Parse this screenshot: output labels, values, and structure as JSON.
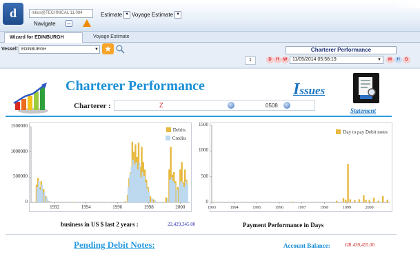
{
  "header": {
    "user": "nikos@TECHNICAL 11.084",
    "estimate_label": "Estimate",
    "voyage_estimate_label": "Voyage Estimate",
    "navigate_label": "Navigate"
  },
  "tabs": [
    {
      "label": "Wizard for EDINBURGH",
      "active": true
    },
    {
      "label": "Voyage Estimate",
      "active": false
    }
  ],
  "toolbar": {
    "vessel_label": "Vessel:",
    "vessel_value": "EDINBURGH",
    "page_number": "1",
    "report_title": "Charterer Performance",
    "date_value": "11/05/2014 05:58:19",
    "nav_left": [
      "D",
      "H",
      "W"
    ],
    "nav_right": [
      "M",
      "H",
      "D"
    ]
  },
  "main": {
    "title": "Charterer Performance",
    "charterer_label": "Charterer :",
    "charterer_value": "Z",
    "charterer_code": "0508",
    "issues_link_initial": "I",
    "issues_link_rest": "ssues",
    "statement_link": "Statement",
    "business_label": "business  in  US $  last 2 years :",
    "business_value": "22,429,345.00",
    "payment_label": "Payment Performance in Days",
    "pending_link": "Pending Debit Notes:",
    "balance_label": "Account Balance:",
    "balance_value": "GR  439,455.00"
  },
  "colors": {
    "title_blue": "#1a8fd6",
    "debits": "#e7b93e",
    "credits": "#bcd9f2",
    "value_red": "#d21a1a"
  },
  "chart_data": [
    {
      "type": "bar",
      "title": "",
      "xlabel": "",
      "ylabel": "",
      "xlim": [
        1990.5,
        2000.6
      ],
      "ylim": [
        0,
        1500000
      ],
      "yticks": [
        "1500000",
        "1000000",
        "500000",
        "0"
      ],
      "xticks": [
        "1992",
        "1994",
        "1996",
        "1998",
        "2000"
      ],
      "legend": "top-right",
      "series": [
        {
          "name": "Debits",
          "color": "#e7b93e",
          "points": [
            [
              1990.85,
              350000
            ],
            [
              1990.95,
              480000
            ],
            [
              1991.05,
              300000
            ],
            [
              1991.15,
              420000
            ],
            [
              1991.3,
              260000
            ],
            [
              1991.45,
              120000
            ],
            [
              1991.6,
              30000
            ],
            [
              1991.75,
              15000
            ],
            [
              1993.2,
              10000
            ],
            [
              1995.3,
              8000
            ],
            [
              1996.5,
              20000
            ],
            [
              1996.65,
              150000
            ],
            [
              1996.75,
              480000
            ],
            [
              1996.85,
              600000
            ],
            [
              1996.95,
              1200000
            ],
            [
              1997.05,
              1000000
            ],
            [
              1997.15,
              1150000
            ],
            [
              1997.25,
              900000
            ],
            [
              1997.35,
              1180000
            ],
            [
              1997.45,
              700000
            ],
            [
              1997.55,
              1100000
            ],
            [
              1997.65,
              800000
            ],
            [
              1997.75,
              650000
            ],
            [
              1997.85,
              450000
            ],
            [
              1997.95,
              300000
            ],
            [
              1998.1,
              120000
            ],
            [
              1998.3,
              60000
            ],
            [
              1999.1,
              100000
            ],
            [
              1999.3,
              650000
            ],
            [
              1999.4,
              1100000
            ],
            [
              1999.5,
              550000
            ],
            [
              1999.6,
              600000
            ],
            [
              1999.7,
              420000
            ],
            [
              1999.85,
              300000
            ],
            [
              2000.0,
              650000
            ],
            [
              2000.1,
              800000
            ],
            [
              2000.2,
              400000
            ],
            [
              2000.3,
              650000
            ],
            [
              2000.4,
              450000
            ]
          ]
        },
        {
          "name": "Credits",
          "color": "#bcd9f2",
          "points": [
            [
              1990.9,
              300000
            ],
            [
              1991.0,
              420000
            ],
            [
              1991.1,
              250000
            ],
            [
              1991.2,
              350000
            ],
            [
              1991.35,
              200000
            ],
            [
              1991.5,
              100000
            ],
            [
              1991.65,
              25000
            ],
            [
              1991.8,
              10000
            ],
            [
              1993.3,
              8000
            ],
            [
              1995.4,
              6000
            ],
            [
              1996.6,
              15000
            ],
            [
              1996.7,
              300000
            ],
            [
              1996.8,
              550000
            ],
            [
              1996.9,
              700000
            ],
            [
              1997.0,
              850000
            ],
            [
              1997.1,
              750000
            ],
            [
              1997.2,
              800000
            ],
            [
              1997.3,
              650000
            ],
            [
              1997.4,
              780000
            ],
            [
              1997.5,
              500000
            ],
            [
              1997.6,
              600000
            ],
            [
              1997.7,
              520000
            ],
            [
              1997.8,
              400000
            ],
            [
              1997.9,
              280000
            ],
            [
              1998.0,
              200000
            ],
            [
              1998.2,
              80000
            ],
            [
              1998.4,
              40000
            ],
            [
              1999.2,
              80000
            ],
            [
              1999.35,
              450000
            ],
            [
              1999.45,
              500000
            ],
            [
              1999.55,
              420000
            ],
            [
              1999.65,
              380000
            ],
            [
              1999.8,
              250000
            ],
            [
              1999.95,
              350000
            ],
            [
              2000.05,
              420000
            ],
            [
              2000.15,
              380000
            ],
            [
              2000.25,
              300000
            ],
            [
              2000.35,
              420000
            ],
            [
              2000.45,
              350000
            ]
          ]
        }
      ]
    },
    {
      "type": "bar",
      "title": "",
      "xlabel": "Payment Performance in Days",
      "ylabel": "",
      "xlim": [
        1993,
        2000.9
      ],
      "ylim": [
        0,
        1500
      ],
      "yticks": [
        "1500",
        "1000",
        "500",
        "0"
      ],
      "xticks": [
        "1993",
        "1994",
        "1995",
        "1996",
        "1997",
        "1998",
        "1999",
        "2000"
      ],
      "legend": "top-right",
      "series": [
        {
          "name": "Day to pay Debit notes",
          "color": "#e7b93e",
          "points": [
            [
              1993.05,
              10
            ],
            [
              1996.6,
              15
            ],
            [
              1998.55,
              30
            ],
            [
              1998.85,
              80
            ],
            [
              1998.95,
              50
            ],
            [
              1999.05,
              750
            ],
            [
              1999.15,
              60
            ],
            [
              1999.35,
              40
            ],
            [
              1999.55,
              60
            ],
            [
              1999.75,
              140
            ],
            [
              1999.85,
              50
            ],
            [
              2000.0,
              40
            ],
            [
              2000.2,
              90
            ],
            [
              2000.4,
              30
            ],
            [
              2000.6,
              120
            ],
            [
              2000.8,
              50
            ]
          ]
        }
      ]
    }
  ]
}
